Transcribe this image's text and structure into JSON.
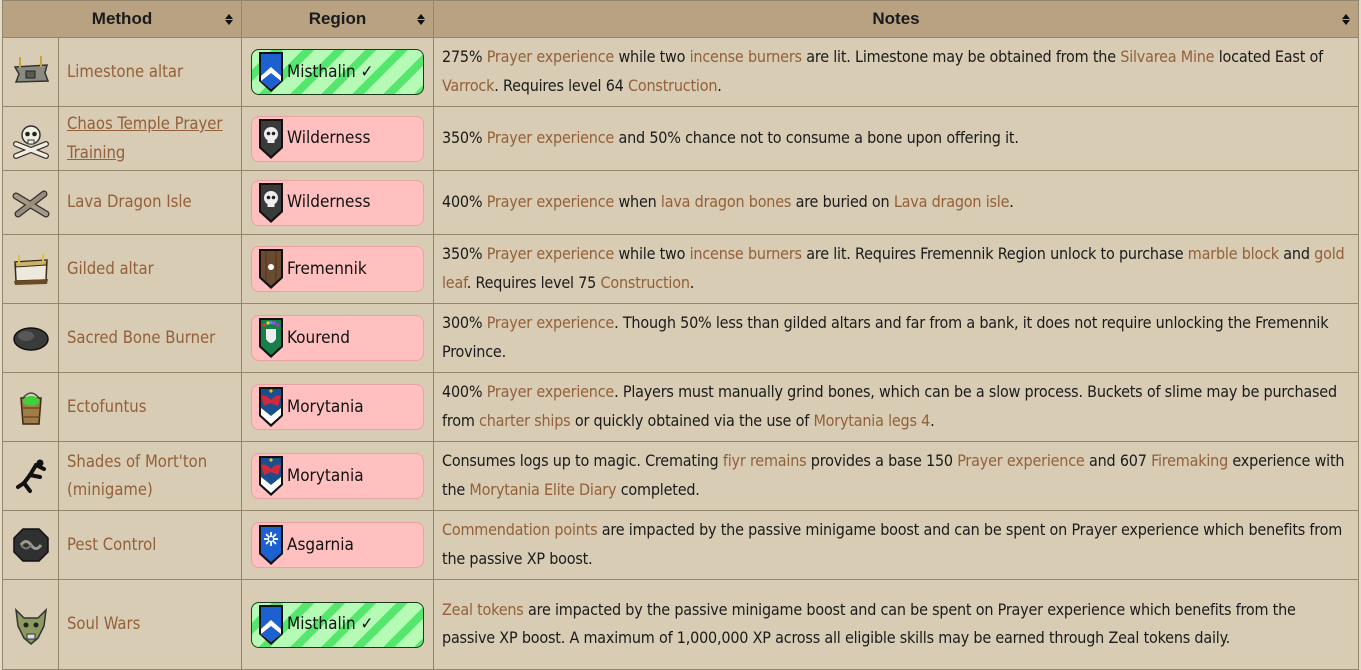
{
  "table": {
    "headers": {
      "method": "Method",
      "region": "Region",
      "notes": "Notes"
    },
    "sort_icon": "sort-up-down-icon",
    "colors": {
      "header_bg": "#b8a282",
      "row_bg": "#d8ccb4",
      "link": "#936039",
      "locked_badge": "#ffc0bf",
      "unlocked_badge_light": "#b5fbb6",
      "unlocked_badge_stripe": "#55e66e"
    },
    "rows": [
      {
        "icon": "limestone-altar-icon",
        "method": "Limestone altar",
        "region": "Misthalin ✓",
        "region_unlocked": true,
        "region_shield": "misthalin-shield-icon",
        "notes": [
          {
            "t": "275% "
          },
          {
            "t": "Prayer experience",
            "link": true
          },
          {
            "t": " while two "
          },
          {
            "t": "incense burners",
            "link": true
          },
          {
            "t": " are lit. Limestone may be obtained from the "
          },
          {
            "t": "Silvarea Mine",
            "link": true
          },
          {
            "t": " located East of "
          },
          {
            "t": "Varrock",
            "link": true
          },
          {
            "t": ". Requires level 64 "
          },
          {
            "t": "Construction",
            "link": true
          },
          {
            "t": "."
          }
        ]
      },
      {
        "icon": "skull-crossbones-icon",
        "method": "Chaos Temple Prayer Training",
        "method_underlined": true,
        "region": "Wilderness",
        "region_unlocked": false,
        "region_shield": "wilderness-shield-icon",
        "notes": [
          {
            "t": "350% "
          },
          {
            "t": "Prayer experience",
            "link": true
          },
          {
            "t": " and 50% chance not to consume a bone upon offering it."
          }
        ]
      },
      {
        "icon": "lava-dragon-bones-icon",
        "method": "Lava Dragon Isle",
        "region": "Wilderness",
        "region_unlocked": false,
        "region_shield": "wilderness-shield-icon",
        "notes": [
          {
            "t": "400% "
          },
          {
            "t": "Prayer experience",
            "link": true
          },
          {
            "t": " when "
          },
          {
            "t": "lava dragon bones",
            "link": true
          },
          {
            "t": " are buried on "
          },
          {
            "t": "Lava dragon isle",
            "link": true
          },
          {
            "t": "."
          }
        ]
      },
      {
        "icon": "gilded-altar-icon",
        "method": "Gilded altar",
        "region": "Fremennik",
        "region_unlocked": false,
        "region_shield": "fremennik-shield-icon",
        "notes": [
          {
            "t": "350% "
          },
          {
            "t": "Prayer experience",
            "link": true
          },
          {
            "t": " while two "
          },
          {
            "t": "incense burners",
            "link": true
          },
          {
            "t": " are lit. Requires Fremennik Region unlock to purchase "
          },
          {
            "t": "marble block",
            "link": true
          },
          {
            "t": " and "
          },
          {
            "t": "gold leaf",
            "link": true
          },
          {
            "t": ". Requires level 75 "
          },
          {
            "t": "Construction",
            "link": true
          },
          {
            "t": "."
          }
        ]
      },
      {
        "icon": "sacred-bone-burner-icon",
        "method": "Sacred Bone Burner",
        "region": "Kourend",
        "region_unlocked": false,
        "region_shield": "kourend-shield-icon",
        "notes": [
          {
            "t": "300% "
          },
          {
            "t": "Prayer experience",
            "link": true
          },
          {
            "t": ". Though 50% less than gilded altars and far from a bank, it does not require unlocking the Fremennik Province."
          }
        ]
      },
      {
        "icon": "bucket-of-slime-icon",
        "method": "Ectofuntus",
        "region": "Morytania",
        "region_unlocked": false,
        "region_shield": "morytania-shield-icon",
        "notes": [
          {
            "t": "400% "
          },
          {
            "t": "Prayer experience",
            "link": true
          },
          {
            "t": ". Players must manually grind bones, which can be a slow process. Buckets of slime may be purchased from "
          },
          {
            "t": "charter ships",
            "link": true
          },
          {
            "t": " or quickly obtained via the use of "
          },
          {
            "t": "Morytania legs 4",
            "link": true
          },
          {
            "t": "."
          }
        ]
      },
      {
        "icon": "shade-remains-icon",
        "method": "Shades of Mort'ton (minigame)",
        "region": "Morytania",
        "region_unlocked": false,
        "region_shield": "morytania-shield-icon",
        "notes": [
          {
            "t": "Consumes logs up to magic. Cremating "
          },
          {
            "t": "fiyr remains",
            "link": true
          },
          {
            "t": " provides a base 150 "
          },
          {
            "t": "Prayer experience",
            "link": true
          },
          {
            "t": " and 607 "
          },
          {
            "t": "Firemaking",
            "link": true
          },
          {
            "t": " experience with the "
          },
          {
            "t": "Morytania Elite Diary",
            "link": true
          },
          {
            "t": " completed."
          }
        ]
      },
      {
        "icon": "pest-control-icon",
        "method": "Pest Control",
        "region": "Asgarnia",
        "region_unlocked": false,
        "region_shield": "asgarnia-shield-icon",
        "notes": [
          {
            "t": "Commendation points",
            "link": true
          },
          {
            "t": " are impacted by the passive minigame boost and can be spent on Prayer experience which benefits from the passive XP boost."
          }
        ]
      },
      {
        "icon": "soul-wars-icon",
        "method": "Soul Wars",
        "region": "Misthalin ✓",
        "region_unlocked": true,
        "region_shield": "misthalin-shield-icon",
        "notes": [
          {
            "t": "Zeal tokens",
            "link": true
          },
          {
            "t": " are impacted by the passive minigame boost and can be spent on Prayer experience which benefits from the passive XP boost. A maximum of 1,000,000 XP across all eligible skills may be earned through Zeal tokens daily."
          }
        ]
      }
    ]
  }
}
